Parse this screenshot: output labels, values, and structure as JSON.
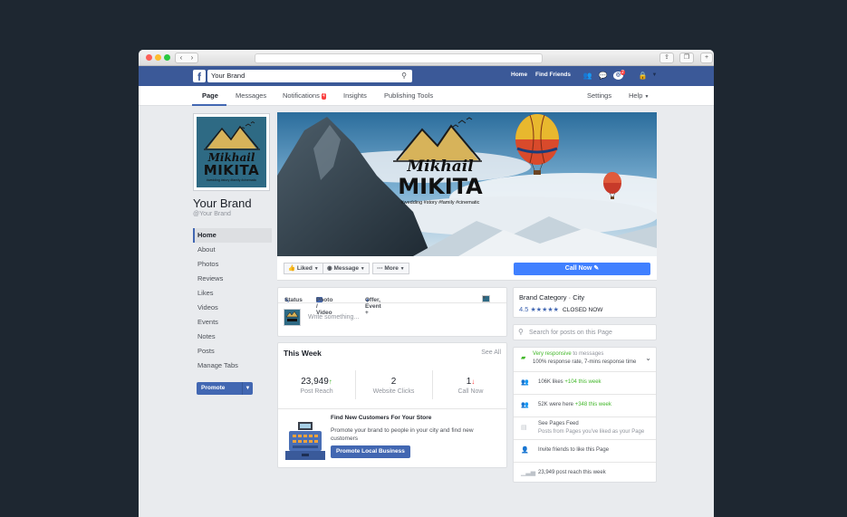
{
  "browser": {
    "nav_back": "‹",
    "nav_forward": "›"
  },
  "fb_bar": {
    "logo": "f",
    "search_value": "Your Brand",
    "links": [
      "Home",
      "Find Friends"
    ],
    "notification_count": "2"
  },
  "subnav": {
    "tabs": [
      "Page",
      "Messages",
      "Notifications",
      "Insights",
      "Publishing Tools"
    ],
    "notifications_badge": "4",
    "right_tabs": [
      "Settings",
      "Help"
    ]
  },
  "profile": {
    "logo_line1": "Mikhail",
    "logo_line2": "MIKITA",
    "logo_tags": "#wedding #story #family #cinematic",
    "name": "Your Brand",
    "handle": "@Your Brand"
  },
  "left_nav": [
    "Home",
    "About",
    "Photos",
    "Reviews",
    "Likes",
    "Videos",
    "Events",
    "Notes",
    "Posts",
    "Manage Tabs"
  ],
  "promote_label": "Promote",
  "cover": {
    "logo_line1": "Mikhail",
    "logo_line2": "MIKITA",
    "logo_tags": "#wedding #story #family #cinematic"
  },
  "actions": {
    "liked": "Liked",
    "message": "Message",
    "more": "More",
    "call_now": "Call Now"
  },
  "composer": {
    "tabs": [
      "Status",
      "Photo / Video",
      "Offer, Event +"
    ],
    "placeholder": "Write something..."
  },
  "this_week": {
    "title": "This Week",
    "see_all": "See All",
    "stats": [
      {
        "value": "23,949",
        "label": "Post Reach",
        "trend": "up"
      },
      {
        "value": "2",
        "label": "Website Clicks",
        "trend": "none"
      },
      {
        "value": "1",
        "label": "Call Now",
        "trend": "down"
      }
    ],
    "promo_title": "Find New Customers For Your Store",
    "promo_text": "Promote your brand to people in your city and find new customers",
    "promo_button": "Promote Local Business"
  },
  "about_card": {
    "category": "Brand Category",
    "city": "City",
    "rating": "4.5",
    "status": "CLOSED NOW"
  },
  "search_posts_placeholder": "Search for posts on this Page",
  "side_info": {
    "responsive": "Very responsive",
    "responsive_suffix": "to messages",
    "response_rate": "100% response rate, 7-mins response time",
    "likes": "106K likes",
    "likes_delta": "+104 this week",
    "checkins": "52K were here",
    "checkins_delta": "+348 this week",
    "feed_title": "See Pages Feed",
    "feed_sub": "Posts from Pages you've liked as your Page",
    "invite": "Invite friends to like this Page",
    "reach": "23,949 post reach this week"
  },
  "colors": {
    "fb_blue": "#3b5998",
    "call_blue": "#4080ff",
    "accent_green": "#42b72a"
  }
}
